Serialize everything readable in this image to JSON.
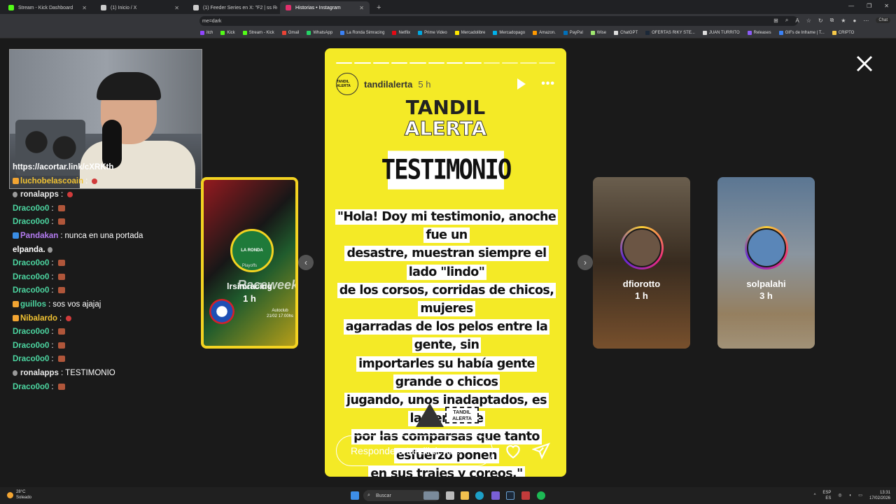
{
  "browser": {
    "tabs": [
      {
        "label": "Stream - Kick Dashboard",
        "color": "#53fc18"
      },
      {
        "label": "(1) Inicio / X",
        "color": "#cccccc"
      },
      {
        "label": "(1) Feeder Series en X: \"F2 | ss Re...",
        "color": "#cccccc"
      },
      {
        "label": "Historias • Instagram",
        "color": "#e1306c"
      }
    ],
    "new_tab": "+",
    "url": "me=dark",
    "chat_button": "Chat",
    "bookmarks": [
      {
        "label": "itch",
        "color": "#9146ff"
      },
      {
        "label": "Kick",
        "color": "#53fc18"
      },
      {
        "label": "Stream - Kick",
        "color": "#53fc18"
      },
      {
        "label": "Gmail",
        "color": "#ea4335"
      },
      {
        "label": "WhatsApp",
        "color": "#25d366"
      },
      {
        "label": "La Ronda Simracing",
        "color": "#3b82f6"
      },
      {
        "label": "Netflix",
        "color": "#e50914"
      },
      {
        "label": "Prime Video",
        "color": "#00a8e1"
      },
      {
        "label": "Mercadolibre",
        "color": "#ffe600"
      },
      {
        "label": "Mercadopago",
        "color": "#00b1ea"
      },
      {
        "label": "Amazon.",
        "color": "#ff9900"
      },
      {
        "label": "PayPal",
        "color": "#0070ba"
      },
      {
        "label": "Wise",
        "color": "#9fe870"
      },
      {
        "label": "ChatGPT",
        "color": "#dddddd"
      },
      {
        "label": "OFERTAS RIKY STE...",
        "color": "#1b2838"
      },
      {
        "label": "JUAN TURRITO",
        "color": "#dddddd"
      },
      {
        "label": "Releases",
        "color": "#8b5cf6"
      },
      {
        "label": "GIFs de Inframe | T...",
        "color": "#3b82f6"
      },
      {
        "label": "CRIPTO",
        "color": "#f7c948"
      }
    ]
  },
  "chat": {
    "link": "https://acortar.link/cXRKth",
    "messages": [
      {
        "user": "luchobelascoain",
        "sep": ":",
        "text": "",
        "color": "yellow",
        "emote": "red"
      },
      {
        "user": "ronalapps",
        "sep": ":",
        "text": "",
        "color": "white",
        "emote": "red"
      },
      {
        "user": "Draco0o0",
        "sep": ":",
        "text": "",
        "color": "green",
        "emote": "brick"
      },
      {
        "user": "Draco0o0",
        "sep": ":",
        "text": "",
        "color": "green",
        "emote": "brick"
      },
      {
        "user": "Pandakan",
        "sep": ":",
        "text": "nunca en una portada",
        "color": "purple",
        "emote": ""
      },
      {
        "user": "",
        "sep": "",
        "text": "elpanda.",
        "color": "white",
        "emote": "grey"
      },
      {
        "user": "Draco0o0",
        "sep": ":",
        "text": "",
        "color": "green",
        "emote": "brick"
      },
      {
        "user": "Draco0o0",
        "sep": ":",
        "text": "",
        "color": "green",
        "emote": "brick"
      },
      {
        "user": "Draco0o0",
        "sep": ":",
        "text": "",
        "color": "green",
        "emote": "brick"
      },
      {
        "user": "guillos",
        "sep": ":",
        "text": "sos vos ajajaj",
        "color": "green",
        "emote": ""
      },
      {
        "user": "Nibalardo",
        "sep": ":",
        "text": "",
        "color": "yellow",
        "emote": "red"
      },
      {
        "user": "Draco0o0",
        "sep": ":",
        "text": "",
        "color": "green",
        "emote": "brick"
      },
      {
        "user": "Draco0o0",
        "sep": ":",
        "text": "",
        "color": "green",
        "emote": "brick"
      },
      {
        "user": "Draco0o0",
        "sep": ":",
        "text": "",
        "color": "green",
        "emote": "brick"
      },
      {
        "user": "ronalapps",
        "sep": ":",
        "text": "TESTIMONIO",
        "color": "white",
        "emote": ""
      },
      {
        "user": "Draco0o0",
        "sep": ":",
        "text": "",
        "color": "green",
        "emote": "brick"
      }
    ]
  },
  "side_stories": [
    {
      "name": "lrsimracing",
      "time": "1 h",
      "overlay1": "LA RONDA",
      "overlay2": "Raceweek",
      "overlay3": "Playoffs",
      "overlay4": "Autoclub",
      "overlay5": "21/02 17:00hs"
    },
    {
      "name": "dfiorotto",
      "time": "1 h"
    },
    {
      "name": "solpalahi",
      "time": "3 h"
    }
  ],
  "story": {
    "username": "tandilalerta",
    "time": "5 h",
    "avatar_text": "TANDIL ALERTA",
    "brand_line1": "TANDIL",
    "brand_line2": "ALERTA",
    "heading": "TESTIMONIO",
    "quote_lines": [
      "\"Hola! Doy mi testimonio, anoche fue un",
      "desastre, muestran siempre el lado \"lindo\"",
      "de los corsos, corridas de chicos, mujeres",
      "agarradas de los pelos entre la gente, sin",
      "importarles su había gente grande o chicos",
      "jugando, unos inadaptados, es lamentable",
      "por las comparsas que tanto esfuerzo ponen",
      "en sus trajes y coreos.\""
    ],
    "logo_text": "TANDIL ALERTA",
    "reply_placeholder": "Responde a tandilalerta...",
    "progress_segments": 12,
    "progress_done": 8
  },
  "taskbar": {
    "temp": "28°C",
    "weather": "Soleado",
    "search": "Buscar",
    "lang1": "ESP",
    "lang2": "ES",
    "time": "13:31",
    "date": "17/02/2026"
  }
}
